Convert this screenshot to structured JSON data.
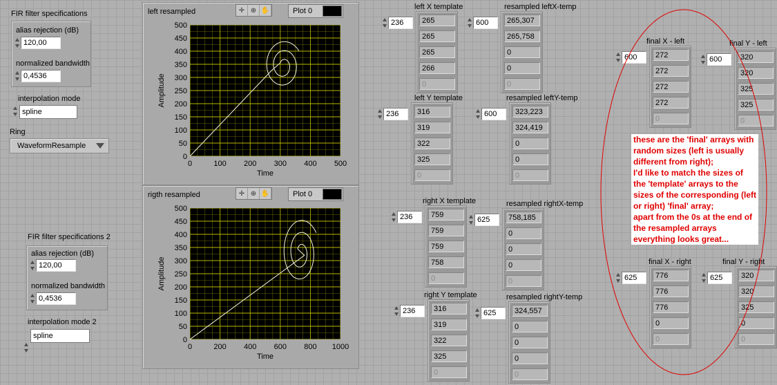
{
  "fir1": {
    "title": "FIR filter specifications",
    "alias_label": "alias rejection (dB)",
    "alias_value": "120,00",
    "bw_label": "normalized bandwidth",
    "bw_value": "0,4536"
  },
  "interp1": {
    "label": "interpolation mode",
    "value": "spline"
  },
  "ring": {
    "label": "Ring",
    "value": "WaveformResample"
  },
  "fir2": {
    "title": "FIR filter specifications 2",
    "alias_label": "alias rejection (dB)",
    "alias_value": "120,00",
    "bw_label": "normalized bandwidth",
    "bw_value": "0,4536"
  },
  "interp2": {
    "label": "interpolation mode 2",
    "value": "spline"
  },
  "graphs": [
    {
      "title": "left resampled",
      "legend": "Plot 0",
      "xlabel": "Time",
      "ylabel": "Amplitude",
      "xticks": [
        "0",
        "100",
        "200",
        "300",
        "400",
        "500"
      ],
      "yticks": [
        "500",
        "450",
        "400",
        "350",
        "300",
        "250",
        "200",
        "150",
        "100",
        "50",
        "0"
      ]
    },
    {
      "title": "rigth resampled",
      "legend": "Plot 0",
      "xlabel": "Time",
      "ylabel": "Amplitude",
      "xticks": [
        "0",
        "200",
        "400",
        "600",
        "800",
        "1000"
      ],
      "yticks": [
        "500",
        "450",
        "400",
        "350",
        "300",
        "250",
        "200",
        "150",
        "100",
        "50",
        "0"
      ]
    }
  ],
  "chart_data": [
    {
      "type": "line",
      "title": "left resampled",
      "xlabel": "Time",
      "ylabel": "Amplitude",
      "xlim": [
        0,
        500
      ],
      "ylim": [
        0,
        500
      ],
      "grid": true,
      "series": [
        {
          "name": "Plot 0",
          "kind": "spiral",
          "center": [
            310,
            345
          ],
          "start": [
            0,
            0
          ],
          "end": [
            270,
            325
          ],
          "line_color": "#f5f5dc"
        }
      ]
    },
    {
      "type": "line",
      "title": "rigth resampled",
      "xlabel": "Time",
      "ylabel": "Amplitude",
      "xlim": [
        0,
        1000
      ],
      "ylim": [
        0,
        500
      ],
      "grid": true,
      "series": [
        {
          "name": "Plot 0",
          "kind": "spiral",
          "center": [
            735,
            330
          ],
          "start": [
            0,
            0
          ],
          "end": [
            760,
            320
          ],
          "line_color": "#f5f5dc"
        }
      ]
    }
  ],
  "arrays": [
    {
      "label": "left X template",
      "index": "236",
      "values": [
        "265",
        "265",
        "265",
        "266",
        "0"
      ]
    },
    {
      "label": "resampled leftX-temp",
      "index": "600",
      "values": [
        "265,307",
        "265,758",
        "0",
        "0",
        "0"
      ]
    },
    {
      "label": "left Y template",
      "index": "236",
      "values": [
        "316",
        "319",
        "322",
        "325",
        "0"
      ]
    },
    {
      "label": "resampled leftY-temp",
      "index": "600",
      "values": [
        "323,223",
        "324,419",
        "0",
        "0",
        "0"
      ]
    },
    {
      "label": "right X template",
      "index": "236",
      "values": [
        "759",
        "759",
        "759",
        "758",
        "0"
      ]
    },
    {
      "label": "resampled rightX-temp",
      "index": "625",
      "values": [
        "758,185",
        "0",
        "0",
        "0",
        "0"
      ]
    },
    {
      "label": "right Y template",
      "index": "236",
      "values": [
        "316",
        "319",
        "322",
        "325",
        "0"
      ]
    },
    {
      "label": "resampled rightY-temp",
      "index": "625",
      "values": [
        "324,557",
        "0",
        "0",
        "0",
        "0"
      ]
    },
    {
      "label": "final X - left",
      "index": "600",
      "values": [
        "272",
        "272",
        "272",
        "272",
        "0"
      ]
    },
    {
      "label": "final Y - left",
      "index": "600",
      "values": [
        "320",
        "320",
        "325",
        "325",
        "0"
      ]
    },
    {
      "label": "final X - right",
      "index": "625",
      "values": [
        "776",
        "776",
        "776",
        "0",
        "0"
      ]
    },
    {
      "label": "final Y - right",
      "index": "625",
      "values": [
        "320",
        "320",
        "325",
        "0",
        "0"
      ]
    }
  ],
  "note": "these are the 'final' arrays with\nrandom sizes (left is usually\ndifferent from right);\nI'd like to match the sizes of\nthe 'template' arrays to the\nsizes of the corresponding (left\nor right) 'final' array;\napart from the 0s at the end of\nthe resampled arrays\neverything looks great...",
  "colors": {
    "plot_bg": "#000000",
    "grid": "#c8c800",
    "trace": "#f5f5dc",
    "note_text": "#e00000",
    "circle": "#e00000"
  }
}
